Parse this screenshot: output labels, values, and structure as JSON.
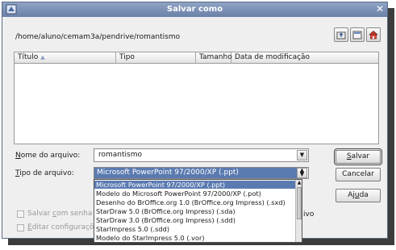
{
  "window": {
    "title": "Salvar como"
  },
  "path": {
    "current": "/home/aluno/cemam3a/pendrive/romantismo"
  },
  "toolbar": {
    "icons": [
      "go-up-icon",
      "new-folder-icon",
      "home-icon"
    ]
  },
  "file_list": {
    "columns": [
      "Título",
      "Tipo",
      "Tamanho",
      "Data de modificação"
    ],
    "sort_column": "Título",
    "rows": []
  },
  "form": {
    "filename_label_pre": "",
    "filename_label_ul": "N",
    "filename_label_post": "ome do arquivo:",
    "filename_value": "romantismo",
    "filetype_label_pre": "",
    "filetype_label_ul": "T",
    "filetype_label_post": "ipo de arquivo:",
    "filetype_value": "Microsoft PowerPoint 97/2000/XP (.ppt)"
  },
  "buttons": {
    "save_pre": "",
    "save_ul": "S",
    "save_post": "alvar",
    "cancel": "Cancelar",
    "help_pre": "Aj",
    "help_ul": "u",
    "help_post": "da"
  },
  "checkboxes": {
    "password_pre": "Salvar ",
    "password_ul": "c",
    "password_post": "om senha",
    "edit_filter_pre": "",
    "edit_filter_ul": "E",
    "edit_filter_post": "ditar configurações de filtro",
    "auto_ext_tail": "ivo"
  },
  "dropdown": {
    "items": [
      "Microsoft PowerPoint 97/2000/XP (.ppt)",
      "Modelo do Microsoft PowerPoint 97/2000/XP (.pot)",
      "Desenho do BrOffice.org 1.0 (BrOffice.org Impress) (.sxd)",
      "StarDraw 5.0 (BrOffice.org Impress) (.sda)",
      "StarDraw 3.0 (BrOffice.org Impress) (.sdd)",
      "StarImpress 5.0 (.sdd)",
      "Modelo do StarImpress 5.0 (.vor)"
    ],
    "selected_index": 0
  },
  "colors": {
    "titlebar": "#7a8fb6",
    "selection": "#5a7ab0"
  }
}
